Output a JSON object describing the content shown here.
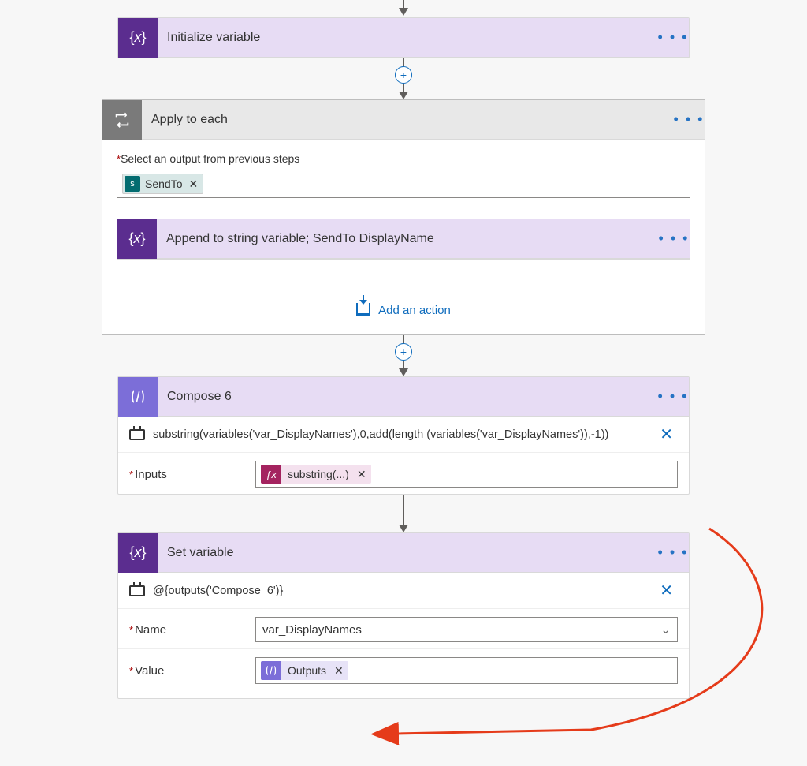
{
  "step1": {
    "title": "Initialize variable"
  },
  "step2": {
    "title": "Apply to each",
    "selectLabel": "Select an output from previous steps",
    "sendToToken": "SendTo",
    "child1": {
      "title": "Append to string variable; SendTo DisplayName"
    },
    "addAction": "Add an action"
  },
  "step3": {
    "title": "Compose 6",
    "peekText": "substring(variables('var_DisplayNames'),0,add(length (variables('var_DisplayNames')),-1))",
    "row1": {
      "label": "Inputs",
      "tokenLabel": "substring(...)"
    }
  },
  "step4": {
    "title": "Set variable",
    "peekText": "@{outputs('Compose_6')}",
    "rowName": {
      "label": "Name",
      "value": "var_DisplayNames"
    },
    "rowValue": {
      "label": "Value",
      "tokenLabel": "Outputs"
    }
  }
}
